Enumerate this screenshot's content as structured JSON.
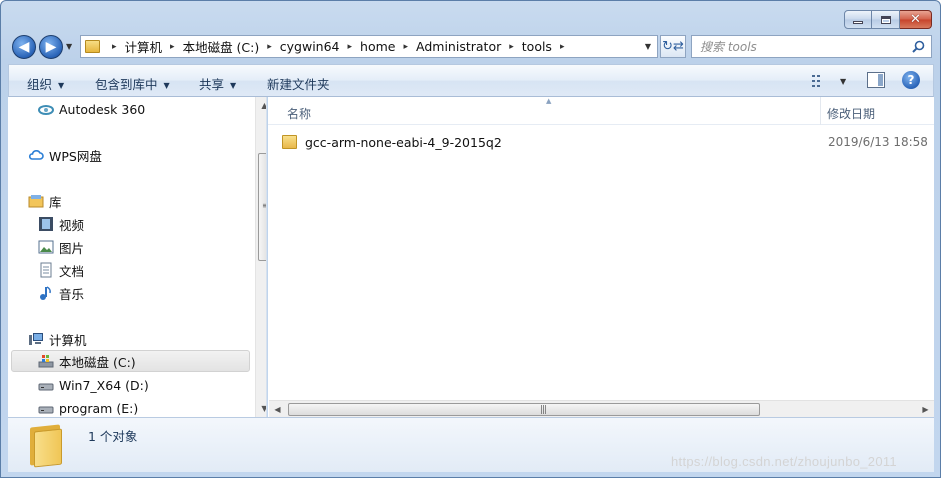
{
  "window": {
    "caption": {
      "minimize_icon": "minimize-icon",
      "maximize_icon": "maximize-icon",
      "close_icon": "close-icon",
      "close_glyph": "✕"
    }
  },
  "nav": {
    "back": "◀",
    "forward": "▶",
    "dropdown": "▼"
  },
  "address": {
    "crumbs": [
      "计算机",
      "本地磁盘 (C:)",
      "cygwin64",
      "home",
      "Administrator",
      "tools"
    ],
    "separator": "▸",
    "dropdown": "▼"
  },
  "refresh": {
    "glyph": "↻⇄"
  },
  "search": {
    "placeholder": "搜索 tools"
  },
  "toolbar": {
    "organize": "组织",
    "include_library": "包含到库中",
    "share": "共享",
    "new_folder": "新建文件夹",
    "arrow": "▼",
    "help": "?"
  },
  "sidebar": {
    "items": [
      {
        "label": "Autodesk 360",
        "icon": "autodesk-icon"
      },
      {
        "label": "WPS网盘",
        "icon": "cloud-icon"
      },
      {
        "label": "库",
        "icon": "library-icon"
      },
      {
        "label": "视频",
        "icon": "video-icon"
      },
      {
        "label": "图片",
        "icon": "picture-icon"
      },
      {
        "label": "文档",
        "icon": "document-icon"
      },
      {
        "label": "音乐",
        "icon": "music-icon"
      },
      {
        "label": "计算机",
        "icon": "computer-icon"
      },
      {
        "label": "本地磁盘 (C:)",
        "icon": "drive-c-icon",
        "selected": true
      },
      {
        "label": "Win7_X64 (D:)",
        "icon": "drive-icon"
      },
      {
        "label": "program (E:)",
        "icon": "drive-icon"
      }
    ],
    "scroll_up": "▲",
    "scroll_down": "▼",
    "grip": "≡"
  },
  "columns": {
    "name": "名称",
    "date": "修改日期",
    "sort_indicator": "▲"
  },
  "files": [
    {
      "name": "gcc-arm-none-eabi-4_9-2015q2",
      "date": "2019/6/13 18:58",
      "icon": "folder-icon"
    }
  ],
  "hscroll": {
    "left": "◀",
    "right": "▶",
    "grip": "|||"
  },
  "details": {
    "count": "1 个对象"
  },
  "watermark": "https://blog.csdn.net/zhoujunbo_2011",
  "colors": {
    "frame": "#c2d6ee",
    "accent": "#2a64b8",
    "close": "#c7432b",
    "folder": "#f0c656"
  }
}
